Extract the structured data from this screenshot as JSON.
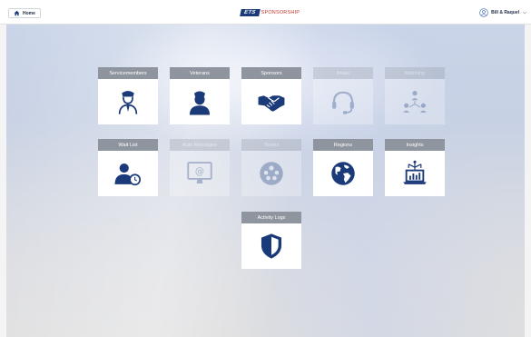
{
  "topbar": {
    "home_label": "Home",
    "logo_mark": "ETS",
    "logo_text": "SPONSORSHIP",
    "user_name": "Bill & Raquel"
  },
  "colors": {
    "brand_blue": "#1b3a7a",
    "brand_red": "#c0392b",
    "tile_header": "#8f959e",
    "icon_color": "#1b3a7a"
  },
  "tiles": [
    {
      "label": "Servicemembers",
      "icon": "servicemember-icon",
      "enabled": true
    },
    {
      "label": "Veterans",
      "icon": "veteran-icon",
      "enabled": true
    },
    {
      "label": "Sponsors",
      "icon": "handshake-icon",
      "enabled": true
    },
    {
      "label": "Intake",
      "icon": "headset-icon",
      "enabled": false
    },
    {
      "label": "Matching",
      "icon": "network-icon",
      "enabled": false
    },
    {
      "label": "Wait List",
      "icon": "user-clock-icon",
      "enabled": true
    },
    {
      "label": "Auto Messages",
      "icon": "email-monitor-icon",
      "enabled": false
    },
    {
      "label": "Teams",
      "icon": "group-icon",
      "enabled": false
    },
    {
      "label": "Regions",
      "icon": "globe-icon",
      "enabled": true
    },
    {
      "label": "Insights",
      "icon": "laptop-analytics-icon",
      "enabled": true
    },
    {
      "label": "Activity Logs",
      "icon": "shield-icon",
      "enabled": true
    }
  ]
}
